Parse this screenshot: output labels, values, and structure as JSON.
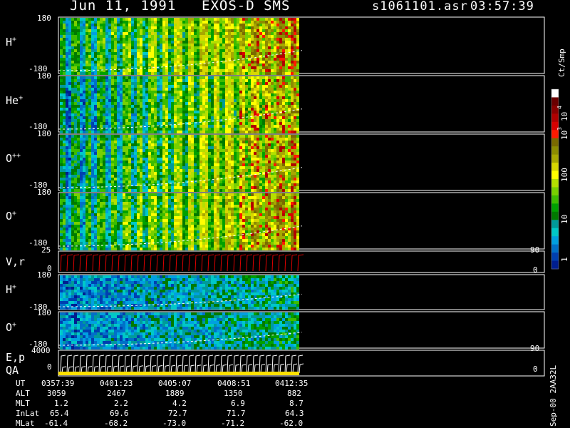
{
  "header": {
    "date": "Jun 11, 1991",
    "instrument": "EXOS-D SMS",
    "file": "s1061101.asr",
    "time": "03:57:39"
  },
  "panels": [
    {
      "label": "H",
      "sup": "+",
      "ymax": "180",
      "ymin": "-180"
    },
    {
      "label": "He",
      "sup": "+",
      "ymax": "180",
      "ymin": "-180"
    },
    {
      "label": "O",
      "sup": "++",
      "ymax": "180",
      "ymin": "-180"
    },
    {
      "label": "O",
      "sup": "+",
      "ymax": "180",
      "ymin": "-180"
    },
    {
      "label": "V,r",
      "sup": "",
      "ymax": "25",
      "ymin": "0",
      "right_top": "90",
      "right_bot": "0"
    },
    {
      "label": "H",
      "sup": "+",
      "ymax": "180",
      "ymin": "-180"
    },
    {
      "label": "O",
      "sup": "+",
      "ymax": "180",
      "ymin": "-180"
    },
    {
      "label": "E,p",
      "label2": "QA",
      "sup": "",
      "ymax": "4000",
      "ymin": "0",
      "right_top": "90",
      "right_bot": "0"
    }
  ],
  "colorbar": {
    "unit": "Ct/Smp",
    "labels": [
      "10",
      "4",
      "10",
      "3",
      "100",
      "10",
      "1"
    ],
    "colors": [
      "#ffffff",
      "#6b0000",
      "#8a0000",
      "#b00000",
      "#d80000",
      "#ff1a00",
      "#7a6a00",
      "#8c8c00",
      "#a8a800",
      "#d8d800",
      "#ffff00",
      "#b4e000",
      "#78d000",
      "#3cbc00",
      "#00a000",
      "#007a00",
      "#009a9a",
      "#00c8c8",
      "#00a0e0",
      "#0070c8",
      "#0040b0",
      "#001e90"
    ]
  },
  "footer": {
    "rows": [
      {
        "label": "UT",
        "values": [
          "0357:39",
          "0401:23",
          "0405:07",
          "0408:51",
          "0412:35"
        ]
      },
      {
        "label": "ALT",
        "values": [
          "3059",
          "2467",
          "1889",
          "1350",
          "882"
        ]
      },
      {
        "label": "MLT",
        "values": [
          "1.2",
          "2.2",
          "4.2",
          "6.9",
          "8.7"
        ]
      },
      {
        "label": "InLat",
        "values": [
          "65.4",
          "69.6",
          "72.7",
          "71.7",
          "64.3"
        ]
      },
      {
        "label": "MLat",
        "values": [
          "-61.4",
          "-68.2",
          "-73.0",
          "-71.2",
          "-62.0"
        ]
      }
    ],
    "stamp": "Sep-00 2AA32L"
  },
  "chart_data": {
    "type": "heatmap",
    "x": [
      "0357:39",
      "0401:23",
      "0405:07",
      "0408:51",
      "0412:35"
    ],
    "series": [
      {
        "name": "H+",
        "ylim": [
          -180,
          180
        ]
      },
      {
        "name": "He+",
        "ylim": [
          -180,
          180
        ]
      },
      {
        "name": "O++",
        "ylim": [
          -180,
          180
        ]
      },
      {
        "name": "O+",
        "ylim": [
          -180,
          180
        ]
      },
      {
        "name": "V,r",
        "ylim": [
          0,
          25
        ]
      },
      {
        "name": "H+",
        "ylim": [
          -180,
          180
        ]
      },
      {
        "name": "O+",
        "ylim": [
          -180,
          180
        ]
      },
      {
        "name": "E,p",
        "ylim": [
          0,
          4000
        ]
      }
    ],
    "colorscale_ticks": [
      "1",
      "10",
      "100",
      "10^3",
      "10^4"
    ]
  }
}
